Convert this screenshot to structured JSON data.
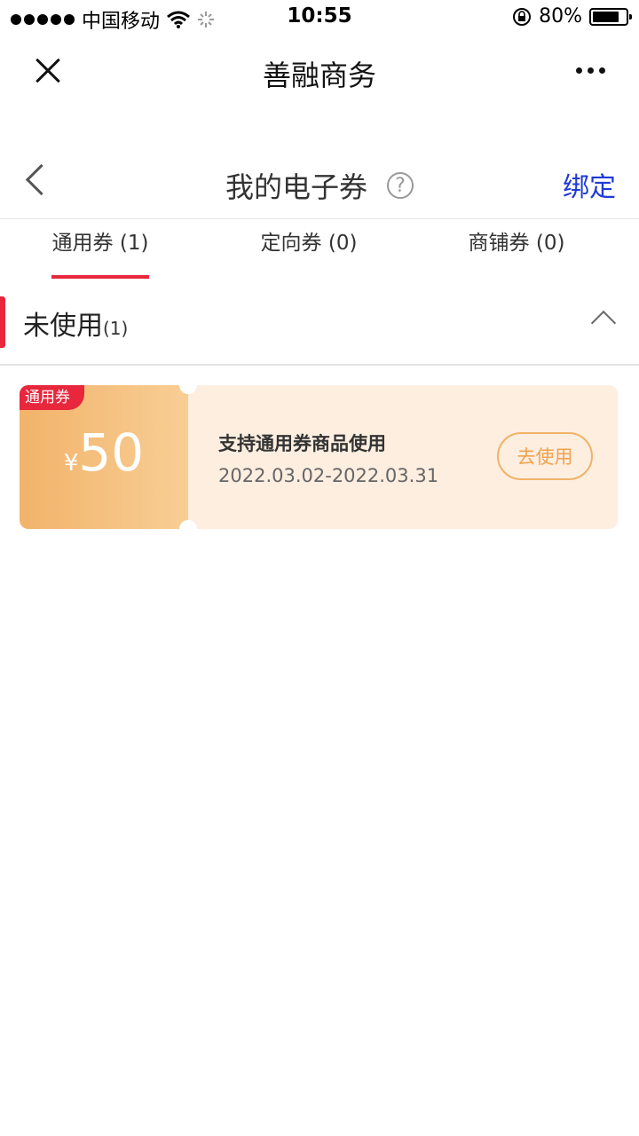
{
  "status_bar": {
    "carrier": "中国移动",
    "time": "10:55",
    "battery": "80%",
    "battery_level": 0.8
  },
  "app_bar": {
    "title": "善融商务"
  },
  "page_header": {
    "title": "我的电子券",
    "help_symbol": "?",
    "action_label": "绑定"
  },
  "tabs": [
    {
      "label": "通用券 (1)",
      "active": true
    },
    {
      "label": "定向券 (0)",
      "active": false
    },
    {
      "label": "商铺券 (0)",
      "active": false
    }
  ],
  "section": {
    "title": "未使用",
    "count": "(1)"
  },
  "coupons": [
    {
      "badge": "通用券",
      "currency": "¥",
      "amount": "50",
      "description": "支持通用券商品使用",
      "date_range": "2022.03.02-2022.03.31",
      "button_label": "去使用"
    }
  ],
  "colors": {
    "accent": "#e8263c",
    "link": "#1f3ad6",
    "coupon_gradient_start": "#f2b36a",
    "coupon_gradient_end": "#f8ce95",
    "coupon_body": "#fdeee0"
  },
  "icons": [
    "signal-dots-icon",
    "wifi-icon",
    "loading-icon",
    "rotation-lock-icon",
    "battery-icon",
    "close-icon",
    "more-icon",
    "back-chevron-icon",
    "help-icon",
    "chevron-up-icon"
  ]
}
